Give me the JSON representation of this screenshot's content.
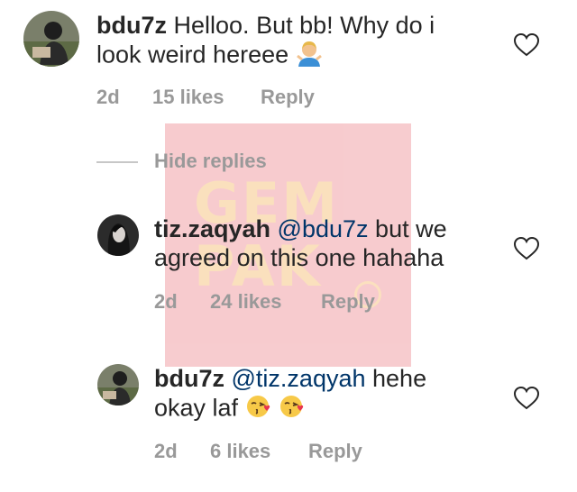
{
  "comments": [
    {
      "username": "bdu7z",
      "text_line1": "Helloo. But bb! Why do i",
      "text_line2": "look weird hereee",
      "emoji": "man-shrugging-emoji",
      "time": "2d",
      "likes": "15 likes",
      "reply": "Reply"
    },
    {
      "username": "tiz.zaqyah",
      "mention": "@bdu7z",
      "text_line1": "but we",
      "text_line2": "agreed on this one hahaha",
      "time": "2d",
      "likes": "24 likes",
      "reply": "Reply"
    },
    {
      "username": "bdu7z",
      "mention": "@tiz.zaqyah",
      "text_line1": "hehe",
      "text_line2": "okay laf",
      "emoji": "kissing-heart-emoji",
      "time": "2d",
      "likes": "6 likes",
      "reply": "Reply"
    }
  ],
  "hide_replies": "Hide replies",
  "watermark": {
    "line1": "GEM",
    "line2": "PAK"
  },
  "colors": {
    "mention": "#003569",
    "meta": "#999999",
    "text": "#262626",
    "watermark_bg": "#f7c9cc"
  }
}
